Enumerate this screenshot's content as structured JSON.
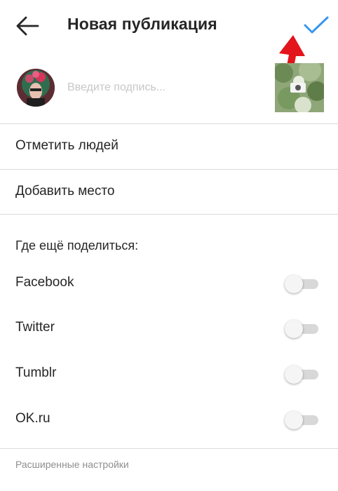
{
  "header": {
    "back_icon": "arrow-left-icon",
    "title": "Новая публикация",
    "confirm_icon": "checkmark-icon",
    "accent_color": "#3897f0"
  },
  "compose": {
    "avatar_icon": "user-avatar",
    "caption_placeholder": "Введите подпись...",
    "caption_value": "",
    "thumbnail": "post-photo-thumbnail"
  },
  "options": [
    {
      "label": "Отметить людей"
    },
    {
      "label": "Добавить место"
    }
  ],
  "share": {
    "title": "Где ещё поделиться:",
    "items": [
      {
        "label": "Facebook",
        "enabled": false
      },
      {
        "label": "Twitter",
        "enabled": false
      },
      {
        "label": "Tumblr",
        "enabled": false
      },
      {
        "label": "OK.ru",
        "enabled": false
      }
    ]
  },
  "advanced_settings": "Расширенные настройки",
  "annotation": {
    "arrow_color": "#e3141b"
  }
}
